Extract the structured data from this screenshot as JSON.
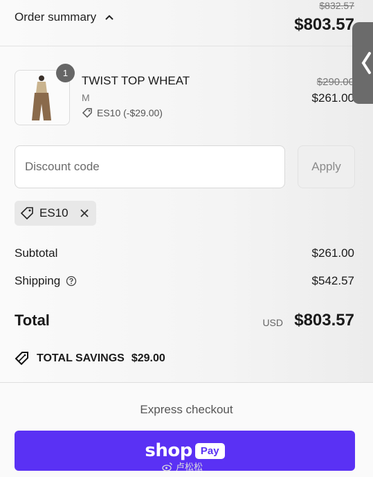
{
  "header": {
    "toggle_label": "Order summary",
    "original_total": "$832.57",
    "total": "$803.57"
  },
  "product": {
    "quantity": "1",
    "name": "TWIST TOP WHEAT",
    "variant": "M",
    "discount": "ES10 (-$29.00)",
    "original_price": "$290.00",
    "price": "$261.00"
  },
  "discount": {
    "placeholder": "Discount code",
    "apply_label": "Apply",
    "applied_code": "ES10"
  },
  "summary": {
    "subtotal_label": "Subtotal",
    "subtotal_value": "$261.00",
    "shipping_label": "Shipping",
    "shipping_value": "$542.57",
    "total_label": "Total",
    "currency": "USD",
    "total_value": "$803.57",
    "savings_label": "TOTAL SAVINGS",
    "savings_value": "$29.00"
  },
  "express": {
    "label": "Express checkout",
    "shop_word": "shop",
    "pay_word": "Pay"
  },
  "watermark": {
    "text": "卢松松"
  },
  "colors": {
    "shop_pay": "#5a31f4",
    "side_tab": "#6b6b6b"
  },
  "icons": [
    "chevron-up-icon",
    "tag-icon",
    "close-icon",
    "help-circle-icon",
    "chevron-left-icon",
    "weibo-icon"
  ]
}
